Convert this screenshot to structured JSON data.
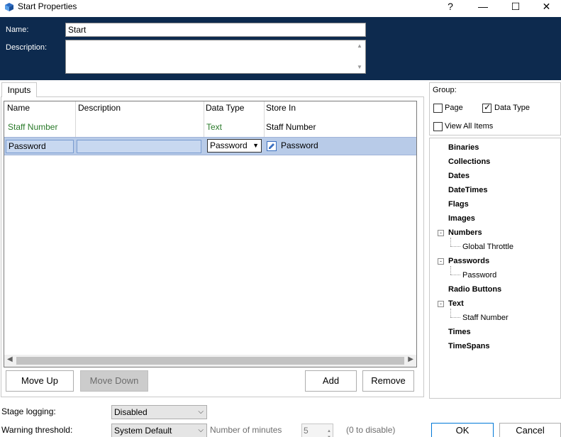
{
  "window": {
    "title": "Start Properties",
    "help_glyph": "?",
    "minimize_glyph": "—",
    "maximize_glyph": "☐",
    "close_glyph": "✕"
  },
  "header": {
    "name_label": "Name:",
    "name_value": "Start",
    "description_label": "Description:",
    "description_value": "",
    "bg_color": "#0d2a4e"
  },
  "inputs_tab": {
    "label": "Inputs",
    "columns": [
      "Name",
      "Description",
      "Data Type",
      "Store In"
    ],
    "rows": [
      {
        "name": "Staff Number",
        "description": "",
        "data_type": "Text",
        "store_in": "Staff Number"
      },
      {
        "name": "Password",
        "description": "",
        "data_type": "Password",
        "store_in": "Password",
        "selected": true
      }
    ],
    "scroll_left_glyph": "◀",
    "scroll_right_glyph": "▶"
  },
  "buttons": {
    "move_up": "Move Up",
    "move_down": "Move Down",
    "add": "Add",
    "remove": "Remove",
    "ok": "OK",
    "cancel": "Cancel"
  },
  "group": {
    "label": "Group:",
    "page_label": "Page",
    "page_checked": false,
    "data_type_label": "Data Type",
    "data_type_checked": true,
    "view_all_label": "View All Items",
    "view_all_checked": false
  },
  "tree": [
    {
      "label": "Binaries"
    },
    {
      "label": "Collections"
    },
    {
      "label": "Dates"
    },
    {
      "label": "DateTimes"
    },
    {
      "label": "Flags"
    },
    {
      "label": "Images"
    },
    {
      "label": "Numbers",
      "children": [
        "Global Throttle"
      ]
    },
    {
      "label": "Passwords",
      "children": [
        "Password"
      ]
    },
    {
      "label": "Radio Buttons"
    },
    {
      "label": "Text",
      "children": [
        "Staff Number"
      ]
    },
    {
      "label": "Times"
    },
    {
      "label": "TimeSpans"
    }
  ],
  "bottom": {
    "stage_logging_label": "Stage logging:",
    "stage_logging_value": "Disabled",
    "warning_threshold_label": "Warning threshold:",
    "warning_threshold_value": "System Default",
    "number_of_minutes_label": "Number of minutes",
    "minutes_value": "5",
    "zero_hint": "(0 to disable)"
  }
}
